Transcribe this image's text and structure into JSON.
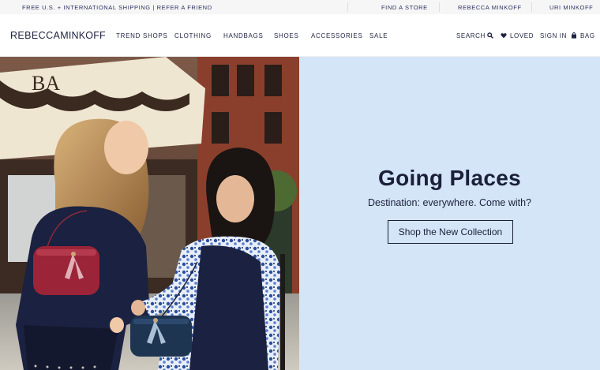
{
  "topbar": {
    "promo_shipping": "FREE U.S. + INTERNATIONAL SHIPPING",
    "promo_divider": " | ",
    "promo_refer": "REFER A FRIEND",
    "find_store": "FIND A STORE",
    "brand_rebecca": "REBECCA MINKOFF",
    "brand_uri": "URI MINKOFF"
  },
  "header": {
    "logo_part1": "REBECCA",
    "logo_part2": "MINKOFF",
    "nav": [
      "TREND SHOPS",
      "CLOTHING",
      "HANDBAGS",
      "SHOES",
      "ACCESSORIES",
      "SALE"
    ],
    "search_label": "SEARCH",
    "loved_label": "LOVED",
    "signin_label": "SIGN IN",
    "bag_label": "BAG"
  },
  "hero": {
    "title": "Going Places",
    "subtitle": "Destination: everywhere. Come with?",
    "cta_label": "Shop the New Collection",
    "awning_text": "BA",
    "panel_color": "#d3e5f7"
  },
  "colors": {
    "navy": "#1d2240",
    "panel": "#d3e5f7",
    "topbar_bg": "#f6f6f6"
  }
}
